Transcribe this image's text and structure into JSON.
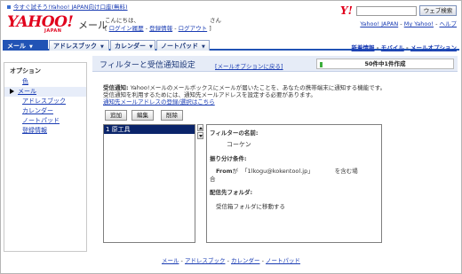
{
  "promo": {
    "text": "今すぐ試そう!Yahoo! JAPAN向け口座(無料)"
  },
  "logo": {
    "brand": "YAHOO!",
    "sub": "JAPAN"
  },
  "header": {
    "service_title": "メール",
    "greeting": "こんにちは、",
    "san": "さん",
    "open_bracket": "[",
    "close_bracket": "]",
    "sep": "-",
    "links": [
      "ログイン履歴",
      "登録情報",
      "ログアウト"
    ]
  },
  "search": {
    "logo": "Y!",
    "placeholder": "",
    "button_label": "ウェブ検索"
  },
  "top_links": {
    "items": [
      "Yahoo! JAPAN",
      "My Yahoo!",
      "ヘルプ"
    ],
    "sep": "-"
  },
  "nav": {
    "tabs": [
      {
        "label": "メール",
        "dropdown": "▼"
      },
      {
        "label": "アドレスブック",
        "dropdown": "▼"
      },
      {
        "label": "カレンダー",
        "dropdown": "▼"
      },
      {
        "label": "ノートパッド",
        "dropdown": "▼"
      }
    ],
    "right_links": [
      "新着情報",
      "モバイル",
      "メールオプション"
    ],
    "sep": "-"
  },
  "sidebar": {
    "heading": "オプション",
    "items": [
      {
        "label": "色"
      },
      {
        "label": "メール"
      },
      {
        "label": "アドレスブック"
      },
      {
        "label": "カレンダー"
      },
      {
        "label": "ノートパッド"
      },
      {
        "label": "登録情報"
      }
    ]
  },
  "main": {
    "title": "フィルターと受信通知設定",
    "back_link": "[メールオプションに戻る]",
    "quota": {
      "text": "50件中1件作成",
      "used": 1,
      "max": 50
    }
  },
  "notice": {
    "label": "受信通知:",
    "line1": "Yahoo!メールのメールボックスにメールが届いたことを、あなたの携帯端末に通知する機能です。",
    "line2": "受信通知を利用するためには、通知先メールアドレスを設定する必要があります。",
    "link": "通知先メールアドレスの登録/選択はこちら"
  },
  "buttons": {
    "add": "追加",
    "edit": "編集",
    "delete": "削除"
  },
  "filters": {
    "items": [
      {
        "label": "1 原工具",
        "selected": true
      }
    ]
  },
  "detail": {
    "name_label": "フィルターの名前:",
    "name_value": "コーケン",
    "cond_label": "振り分け条件:",
    "cond_from": "From",
    "cond_ga": "が",
    "cond_email": "「1lkogu@kokentool.jp」",
    "cond_contains": "を含む場",
    "cond_ai": "合",
    "folder_label": "配信先フォルダ:",
    "folder_value": "受信箱フォルダに移動する"
  },
  "footer": {
    "links": [
      "メール",
      "アドレスブック",
      "カレンダー",
      "ノートパッド"
    ],
    "sep": "-"
  },
  "colors": {
    "accent": "#2153b5",
    "brand": "#e1001c",
    "selected": "#0a246a",
    "quota_fill": "#3cae3c"
  }
}
